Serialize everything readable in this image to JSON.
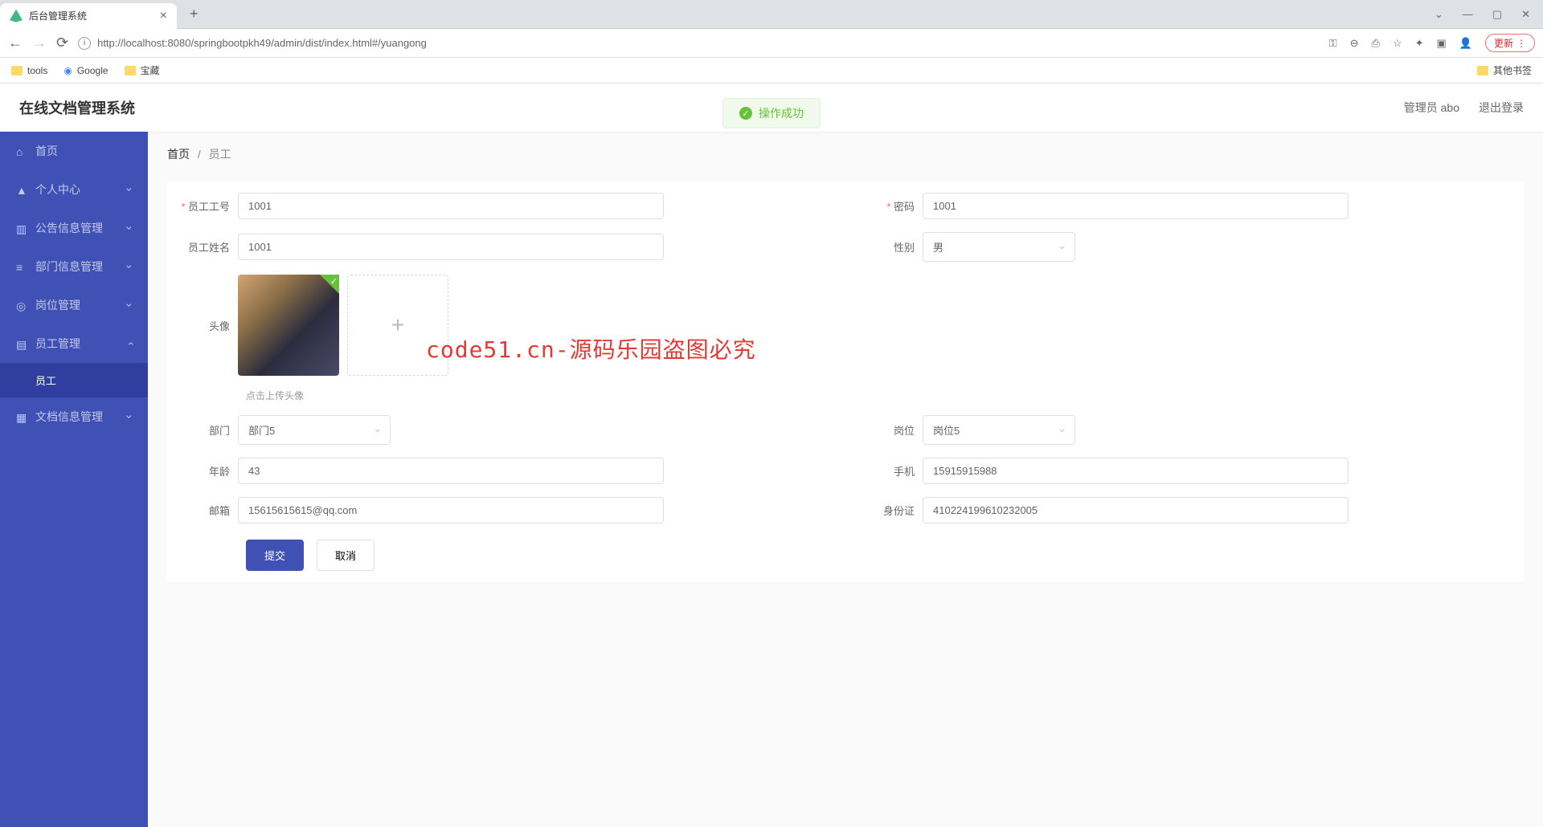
{
  "browser": {
    "tab_title": "后台管理系统",
    "url": "http://localhost:8080/springbootpkh49/admin/dist/index.html#/yuangong",
    "update_label": "更新"
  },
  "bookmarks": {
    "tools": "tools",
    "google": "Google",
    "collection": "宝藏",
    "other": "其他书签"
  },
  "app": {
    "title": "在线文档管理系统",
    "admin_label": "管理员 abo",
    "logout": "退出登录",
    "toast": "操作成功"
  },
  "watermark": {
    "small": "code51.cn",
    "main": "code51.cn-源码乐园盗图必究"
  },
  "sidebar": {
    "home": "首页",
    "personal": "个人中心",
    "notice": "公告信息管理",
    "department": "部门信息管理",
    "position": "岗位管理",
    "employee": "员工管理",
    "employee_sub": "员工",
    "document": "文档信息管理"
  },
  "breadcrumb": {
    "home": "首页",
    "current": "员工"
  },
  "form": {
    "emp_id_label": "员工工号",
    "emp_id_value": "1001",
    "password_label": "密码",
    "password_value": "1001",
    "name_label": "员工姓名",
    "name_value": "1001",
    "gender_label": "性别",
    "gender_value": "男",
    "avatar_label": "头像",
    "upload_hint": "点击上传头像",
    "dept_label": "部门",
    "dept_value": "部门5",
    "position_label": "岗位",
    "position_value": "岗位5",
    "age_label": "年龄",
    "age_value": "43",
    "phone_label": "手机",
    "phone_value": "15915915988",
    "email_label": "邮箱",
    "email_value": "15615615615@qq.com",
    "idcard_label": "身份证",
    "idcard_value": "410224199610232005",
    "submit": "提交",
    "cancel": "取消"
  }
}
